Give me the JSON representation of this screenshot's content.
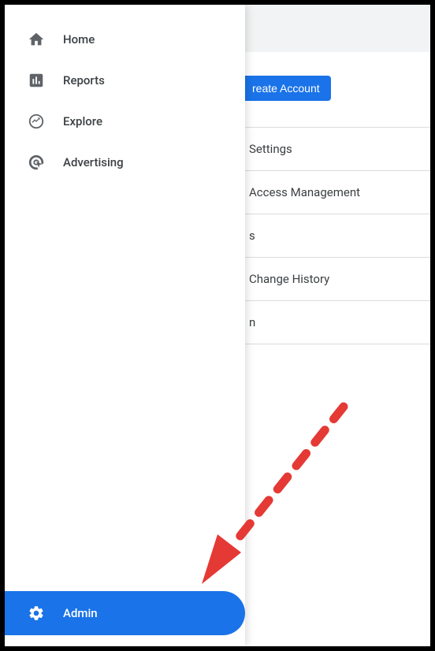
{
  "sidebar": {
    "items": [
      {
        "label": "Home"
      },
      {
        "label": "Reports"
      },
      {
        "label": "Explore"
      },
      {
        "label": "Advertising"
      }
    ],
    "admin_label": "Admin"
  },
  "create_account_label": "reate Account",
  "settings_items": [
    "Settings",
    "Access Management",
    "s",
    "Change History",
    "n"
  ],
  "colors": {
    "primary": "#1a73e8",
    "arrow": "#d93025"
  }
}
